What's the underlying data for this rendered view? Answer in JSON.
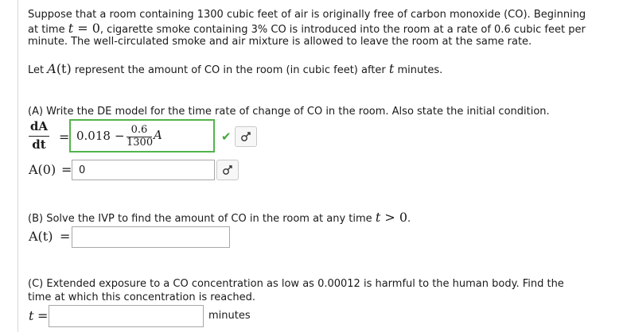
{
  "intro": {
    "line1": "Suppose that a room containing 1300 cubic feet of air is originally free of carbon monoxide (CO). Beginning",
    "line2_a": "at time ",
    "line2_t": "t",
    "line2_eq": " = 0",
    "line2_b": ", cigarette smoke containing 3% CO is introduced into the room at a rate of 0.6 cubic feet per",
    "line3": "minute. The well-circulated smoke and air mixture is allowed to leave the room at the same rate."
  },
  "definition": {
    "a": "Let ",
    "func": "A",
    "arg": "(t)",
    "b": " represent the amount of CO in the room (in cubic feet) after ",
    "t": "t",
    "c": " minutes."
  },
  "part_a": {
    "prompt": "(A) Write the DE model for the time rate of change of CO in the room. Also state the initial condition.",
    "lhs_num": "dA",
    "lhs_den": "dt",
    "equals": "=",
    "answer_const": "0.018",
    "answer_minus": "−",
    "answer_frac_num": "0.6",
    "answer_frac_den": "1300",
    "answer_var": "A",
    "check_mark": "✔",
    "ic_label": "A(0)",
    "ic_equals": "=",
    "ic_value": "0"
  },
  "part_b": {
    "prompt_a": "(B) Solve the IVP to find the amount of CO in the room at any time ",
    "prompt_t": "t",
    "prompt_gt": " > 0",
    "prompt_end": ".",
    "label": "A(t)",
    "equals": "=",
    "value": ""
  },
  "part_c": {
    "line1": "(C) Extended exposure to a CO concentration as low as 0.00012 is harmful to the human body. Find the",
    "line2": "time at which this concentration is reached.",
    "label": "t",
    "equals": "=",
    "value": "",
    "unit": "minutes"
  },
  "icons": [
    "check-icon",
    "male-female-symbol-icon"
  ],
  "colors": {
    "correct_border": "#53b44b",
    "check": "#43a83b"
  }
}
